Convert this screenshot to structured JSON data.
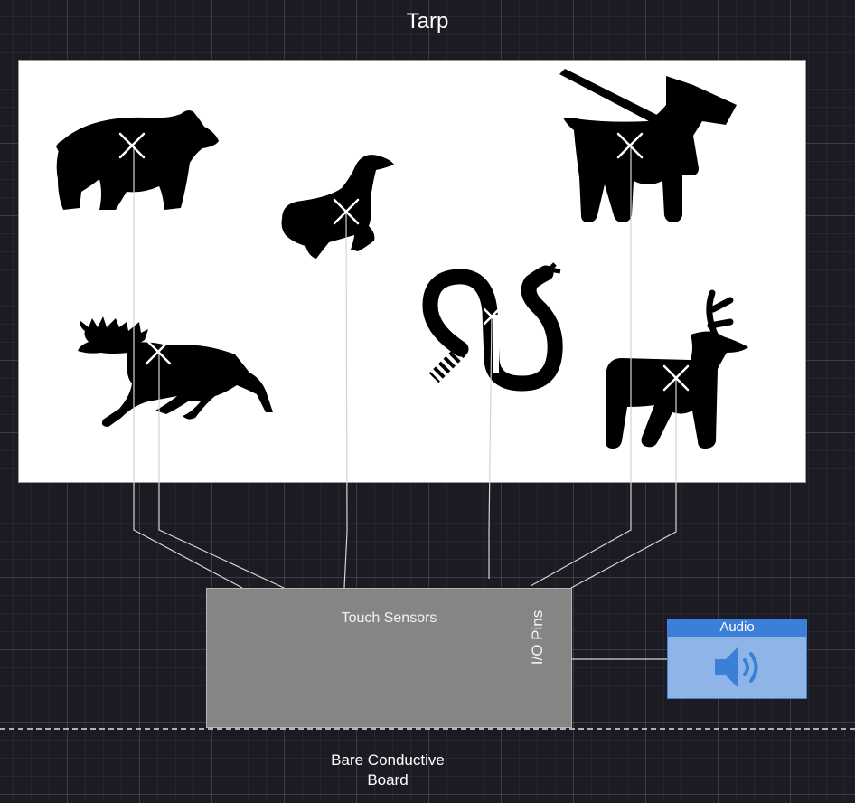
{
  "title": "Tarp",
  "board": {
    "title": "Touch Sensors",
    "io_label": "I/O Pins",
    "caption_line1": "Bare Conductive",
    "caption_line2": "Board"
  },
  "audio": {
    "label": "Audio",
    "icon": "speaker-icon"
  },
  "animals": [
    "bear-icon",
    "seal-icon",
    "dog-icon",
    "moose-icon",
    "snake-icon",
    "deer-icon"
  ],
  "colors": {
    "background": "#1c1a23",
    "tarp": "#ffffff",
    "board": "#858585",
    "audio_fill": "#8fb4e8",
    "audio_header": "#3b7fd9",
    "wire": "#cccccc"
  }
}
